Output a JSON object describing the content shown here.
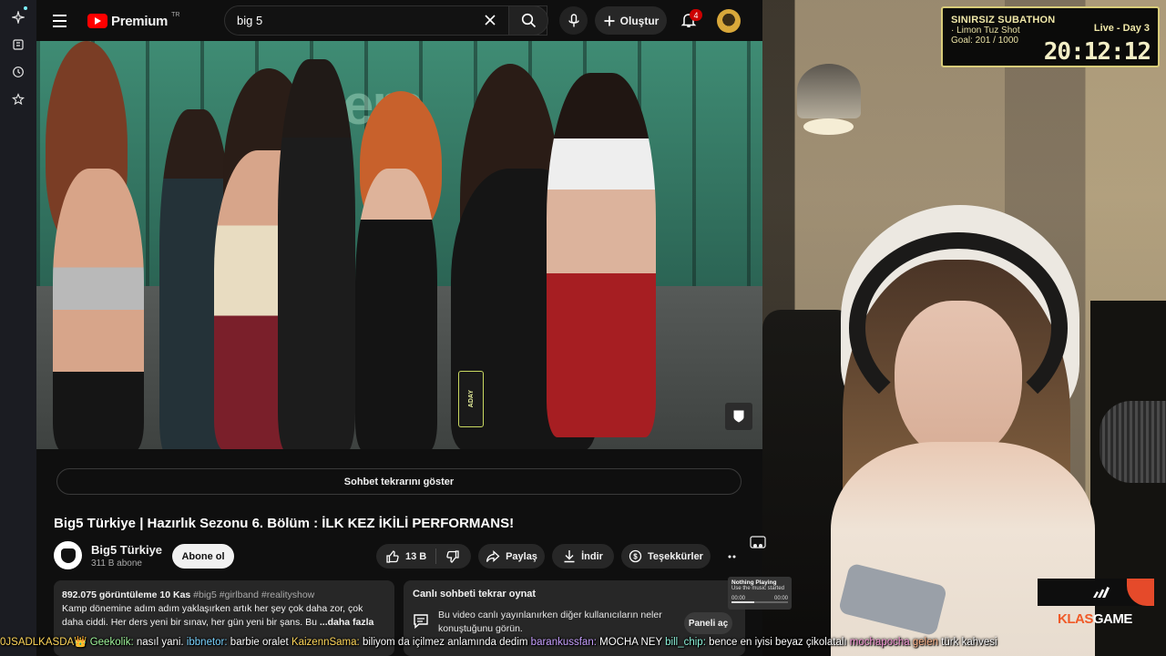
{
  "header": {
    "logo_text": "Premium",
    "logo_region": "TR",
    "search_value": "big 5",
    "create_label": "Oluştur",
    "notifications_count": "4"
  },
  "video": {
    "chat_replay_label": "Sohbet tekrarını göster",
    "title": "Big5 Türkiye | Hazırlık Sezonu 6. Bölüm : İLK KEZ İKİLİ PERFORMANS!",
    "overlay_text": "pers",
    "badge_text": "ADAY"
  },
  "channel": {
    "name": "Big5 Türkiye",
    "subscribers": "311 B abone",
    "subscribe_label": "Abone ol"
  },
  "actions": {
    "likes": "13 B",
    "share": "Paylaş",
    "download": "İndir",
    "thanks": "Teşekkürler"
  },
  "description": {
    "views": "892.075 görüntüleme",
    "date": "10 Kas",
    "tags": "#big5 #girlband #realityshow",
    "text": "Kamp dönemine adım adım yaklaşırken artık her şey çok daha zor, çok daha ciddi. Her ders yeni bir sınav, her gün yeni bir şans. Bu",
    "more": "...daha fazla"
  },
  "live_chat": {
    "title": "Canlı sohbeti tekrar oynat",
    "body": "Bu video canlı yayınlanırken diğer kullanıcıların neler konuştuğunu görün.",
    "button": "Paneli aç"
  },
  "subathon": {
    "title": "SINIRSIZ SUBATHON",
    "status": "Live - Day 3",
    "line1": "· Limon Tuz Shot",
    "line2": "Goal: 201 / 1000",
    "timer": "20:12:12"
  },
  "now_playing": {
    "title": "Nothing Playing",
    "subtitle": "Use the music started",
    "time_start": "00:00",
    "time_end": "00:00"
  },
  "brand": {
    "name_a": "KLAS",
    "name_b": "GAME"
  },
  "ticker": [
    {
      "user": "0JSADLKASDA",
      "msg": ""
    },
    {
      "user": "Geekolik:",
      "msg": "nasıl yani."
    },
    {
      "user": "ibbnetor:",
      "msg": "barbie oralet"
    },
    {
      "user": "KaizennSama:",
      "msg": "biliyom da içilmez anlamında dedim"
    },
    {
      "user": "barankussfan:",
      "msg": "MOCHA NEY"
    },
    {
      "user": "bill_chip:",
      "msg": "bence en iyisi beyaz çikolatalı"
    },
    {
      "user": "mochapocha",
      "msg": ""
    },
    {
      "user": "gelen",
      "msg": "türk kahvesi"
    }
  ],
  "colors": {
    "background": "#0f0f0f",
    "accent_red": "#ff0000",
    "subathon_border": "#d8cc7a"
  }
}
